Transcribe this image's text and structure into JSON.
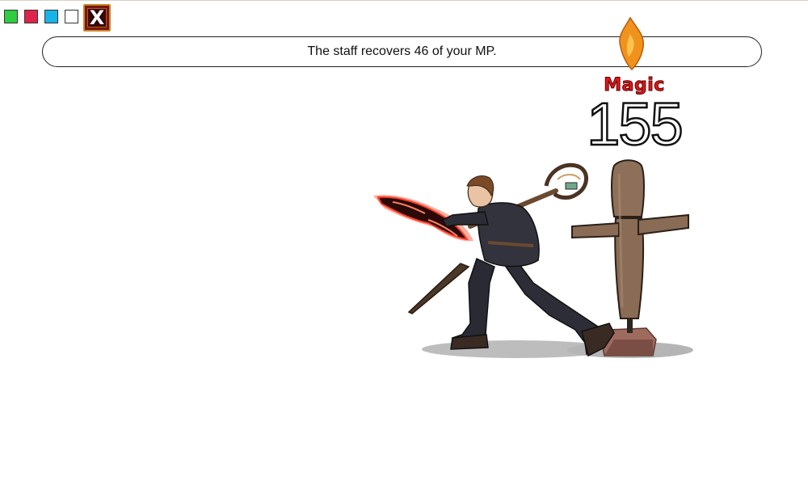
{
  "toolbar": {
    "swatches": [
      {
        "name": "green",
        "color": "#2ecc40"
      },
      {
        "name": "red",
        "color": "#e0234d"
      },
      {
        "name": "blue",
        "color": "#18b4e8"
      },
      {
        "name": "white",
        "color": "#ffffff"
      }
    ],
    "close_label": "X"
  },
  "message": {
    "text": "The staff recovers 46 of your MP."
  },
  "combat_popup": {
    "label": "Magic",
    "value": "155",
    "label_color": "#e0161a"
  },
  "scene": {
    "player": "hero-with-staff-icon",
    "target": "training-dummy-icon",
    "effect": "mana-flame-icon"
  }
}
